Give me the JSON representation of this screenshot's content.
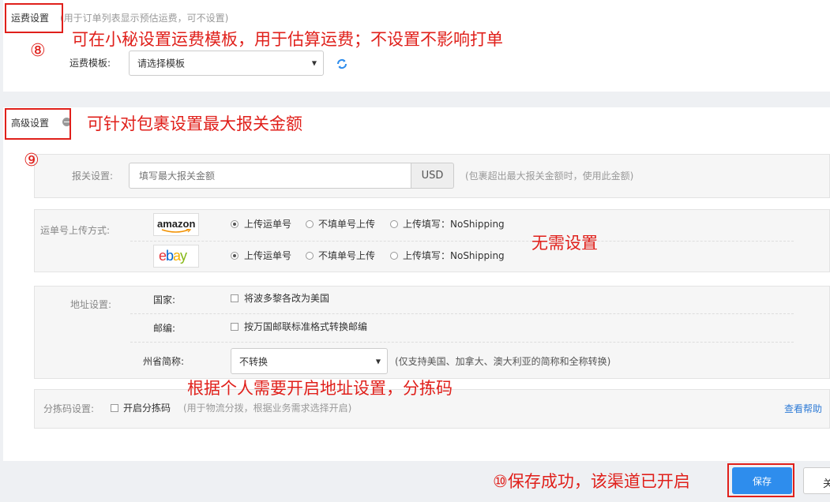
{
  "shipping_fee": {
    "title": "运费设置",
    "hint": "(用于订单列表显示预估运费，可不设置)",
    "template_label": "运费模板:",
    "template_value": "请选择模板"
  },
  "advanced": {
    "title": "高级设置",
    "customs": {
      "label": "报关设置:",
      "placeholder": "填写最大报关金额",
      "currency": "USD",
      "hint": "(包裹超出最大报关金额时，使用此金额)"
    },
    "tracking": {
      "label": "运单号上传方式:",
      "platforms": [
        {
          "logo": "amazon",
          "options": [
            "上传运单号",
            "不填单号上传",
            "上传填写：NoShipping"
          ],
          "selected": 0
        },
        {
          "logo": "ebay",
          "options": [
            "上传运单号",
            "不填单号上传",
            "上传填写：NoShipping"
          ],
          "selected": 0
        }
      ]
    },
    "address": {
      "label": "地址设置:",
      "country_label": "国家:",
      "country_option": "将波多黎各改为美国",
      "zip_label": "邮编:",
      "zip_option": "按万国邮联标准格式转换邮编",
      "state_label": "州省简称:",
      "state_value": "不转换",
      "state_hint": "(仅支持美国、加拿大、澳大利亚的简称和全称转换)"
    },
    "sorting": {
      "label": "分拣码设置:",
      "option": "开启分拣码",
      "hint": "(用于物流分拨，根据业务需求选择开启)",
      "help": "查看帮助"
    }
  },
  "footer": {
    "save_label": "保存",
    "close_label": "关"
  },
  "annotations": {
    "a8_num": "⑧",
    "a8_text": "可在小秘设置运费模板，用于估算运费；不设置不影响打单",
    "a9_text": "可针对包裹设置最大报关金额",
    "a9_num": "⑨",
    "no_need": "无需设置",
    "address_note": "根据个人需要开启地址设置，分拣码",
    "a10_text": "⑩保存成功，该渠道已开启"
  },
  "colors": {
    "annotation_red": "#e0201b",
    "save_blue": "#2e8ded",
    "link_blue": "#2e7bd6"
  }
}
